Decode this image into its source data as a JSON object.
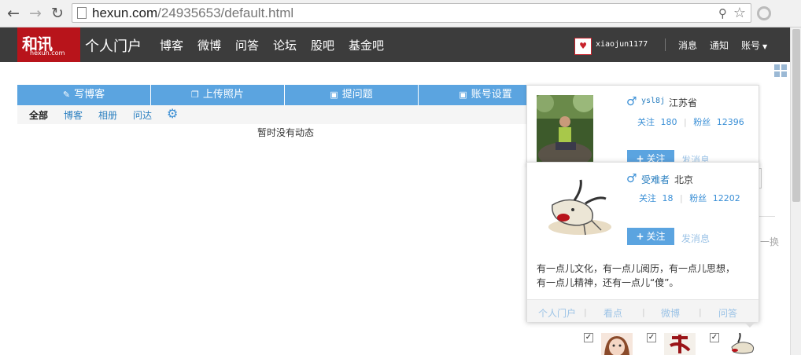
{
  "browser": {
    "url_host": "hexun.com",
    "url_path": "/24935653/default.html"
  },
  "site": {
    "logo_main": "和讯",
    "logo_sub": "hexun.com",
    "portal_title": "个人门户",
    "nav": [
      "博客",
      "微博",
      "问答",
      "论坛",
      "股吧",
      "基金吧"
    ],
    "username": "xiaojun1177",
    "right_links": [
      "消息",
      "通知",
      "账号"
    ]
  },
  "actions": [
    "写博客",
    "上传照片",
    "提问题",
    "账号设置"
  ],
  "filters": [
    "全部",
    "博客",
    "相册",
    "问达"
  ],
  "empty_message": "暂时没有动态",
  "card1": {
    "name": "ysl8j",
    "location": "江苏省",
    "follow_label": "关注",
    "follow_count": "180",
    "fans_label": "粉丝",
    "fans_count": "12396",
    "follow_button": "关注",
    "message_button": "发消息"
  },
  "card2": {
    "name": "受难者",
    "location": "北京",
    "follow_label": "关注",
    "follow_count": "18",
    "fans_label": "粉丝",
    "fans_count": "12202",
    "follow_button": "关注",
    "message_button": "发消息",
    "bio_line1": "有一点儿文化，有一点儿阅历，有一点儿思想，",
    "bio_line2": "有一点儿精神，还有一点儿“傻”。",
    "links": [
      "个人门户",
      "看点",
      "微博",
      "问答"
    ]
  },
  "right_side_text": "一换",
  "colors": {
    "nav_bg": "#3c3c3c",
    "logo_red": "#b8141b",
    "accent_blue": "#5ba4e0",
    "link_blue": "#2a7fc0"
  }
}
